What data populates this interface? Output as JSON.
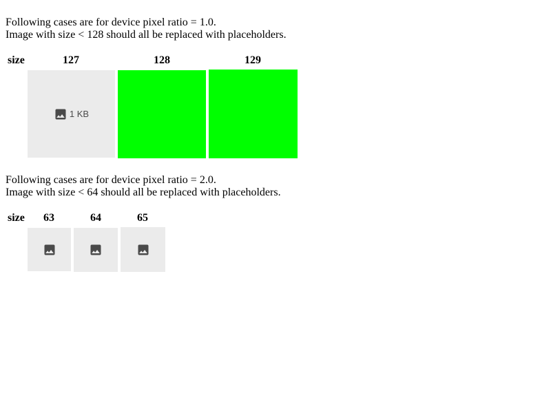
{
  "section1": {
    "line1": "Following cases are for device pixel ratio = 1.0.",
    "line2": "Image with size < 128 should all be replaced with placeholders.",
    "size_header": "size",
    "columns": [
      "127",
      "128",
      "129"
    ],
    "placeholder_size_label": "1 KB",
    "image_color": "#00ff00"
  },
  "section2": {
    "line1": "Following cases are for device pixel ratio = 2.0.",
    "line2": "Image with size < 64 should all be replaced with placeholders.",
    "size_header": "size",
    "columns": [
      "63",
      "64",
      "65"
    ]
  },
  "colors": {
    "placeholder_bg": "#ebebeb",
    "icon": "#4a4a4a"
  },
  "icons": {
    "placeholder": "image-icon"
  }
}
